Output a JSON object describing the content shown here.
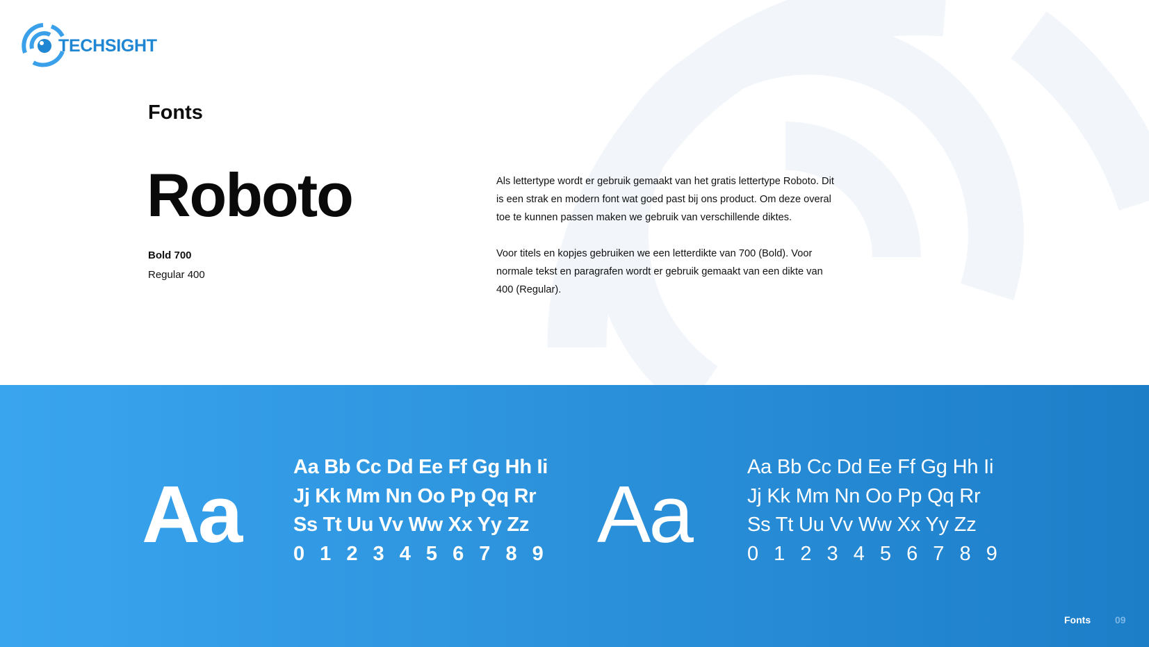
{
  "brand": {
    "name": "TECHSIGHT",
    "primary_color": "#1f86d4",
    "logo_icon": "eye-target-icon"
  },
  "slide": {
    "title": "Fonts",
    "font_name": "Roboto",
    "weights": {
      "bold": "Bold 700",
      "regular": "Regular 400"
    },
    "description": [
      "Als lettertype wordt er gebruik gemaakt van het gratis lettertype Roboto. Dit is een strak en modern font wat goed past bij ons product. Om deze overal toe te kunnen passen maken we gebruik van verschillende diktes.",
      "Voor titels en kopjes gebruiken we een letterdikte van 700 (Bold). Voor normale tekst en paragrafen wordt er gebruik gemaakt van een dikte van 400 (Regular)."
    ]
  },
  "specimens": {
    "sample": "Aa",
    "lines": [
      "Aa Bb Cc Dd Ee Ff Gg Hh Ii",
      "Jj Kk Mm Nn Oo Pp Qq Rr",
      "Ss Tt Uu Vv Ww Xx Yy Zz",
      "0 1 2 3 4 5 6 7 8 9"
    ]
  },
  "footer": {
    "label": "Fonts",
    "page": "09"
  },
  "colors": {
    "band_start": "#3aa5ef",
    "band_end": "#1d7ec8",
    "watermark": "#f3f7fc"
  }
}
